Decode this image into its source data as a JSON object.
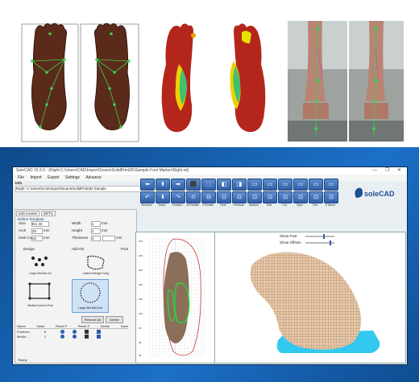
{
  "window": {
    "title": "SoleCAD 10.3.6 - (Right:C:\\Users\\CAD\\Import\\Scans\\SolidPrint3D\\Sample Foot Marker\\Right.stl)",
    "controls": "— ❐ ✕"
  },
  "menu": [
    "File",
    "Import",
    "Export",
    "Settings",
    "Advance"
  ],
  "path": {
    "label": "Info",
    "value": "Right: C:\\Users\\CAD\\Import\\Scans\\SolidPrint3D Sample"
  },
  "toolbar": {
    "row1": [
      "⬅",
      "⬆",
      "➡",
      "⬛",
      "⬚",
      "◧",
      "◨",
      "▭",
      "▭",
      "▭",
      "▭",
      "▭",
      "▭"
    ],
    "row2": [
      "↶",
      "⬇",
      "↷",
      "⊙",
      "⊟",
      "⊡",
      "⊡",
      "⊡",
      "⊡",
      "⊡",
      "⊡",
      "⊡",
      "⊡"
    ],
    "labels": [
      "Reverse",
      "Down",
      "Forward",
      "Ax Rotate",
      "Z Rotate",
      "Heel",
      "Forefoot",
      "Midfoot",
      "Edit",
      "Cut",
      "Sync",
      "Trim",
      "Z Mirror"
    ]
  },
  "brand": {
    "logo": "soleCAD"
  },
  "tabs": [
    "Edit Insoles",
    "DFT1"
  ],
  "define_template": "Define Template",
  "form": {
    "size_label": "Size",
    "size_value": "EU 40",
    "arch_label": "Arch",
    "arch_value": "25",
    "arch_unit": "mm",
    "heelcup_label": "Heel Cup",
    "heelcup_value": "25",
    "heelcup_unit": "mm",
    "width_label": "Width",
    "width_value": "1",
    "height_label": "Height",
    "height_value": "1",
    "thickness_label": "Thickness",
    "thickness_value": "3",
    "unit_mm": "mm"
  },
  "subtabs": [
    "Design",
    "Add-On",
    "Post"
  ],
  "addons": [
    {
      "label": "Large Met Bar Kit"
    },
    {
      "label": "Lateral Wedge 5 deg"
    },
    {
      "label": "Medial Column Post"
    },
    {
      "label": "Large Met Ball Sort"
    }
  ],
  "actions": {
    "remove": "Remove All",
    "delete": "Delete"
  },
  "table": {
    "headers": [
      "Name",
      "Value",
      "Reset P",
      "Reset S",
      "Delete",
      "Save"
    ],
    "rows": [
      {
        "name": "Forefoot...",
        "value": "5"
      },
      {
        "name": "Medio...",
        "value": "2"
      }
    ]
  },
  "sliders": {
    "show_post": "Show Post",
    "show_offsets": "Show Offsets"
  },
  "status": "Ready",
  "colors": {
    "accent": "#1c70c8",
    "mesh": "#e8c8a8",
    "base": "#33c8f0"
  }
}
